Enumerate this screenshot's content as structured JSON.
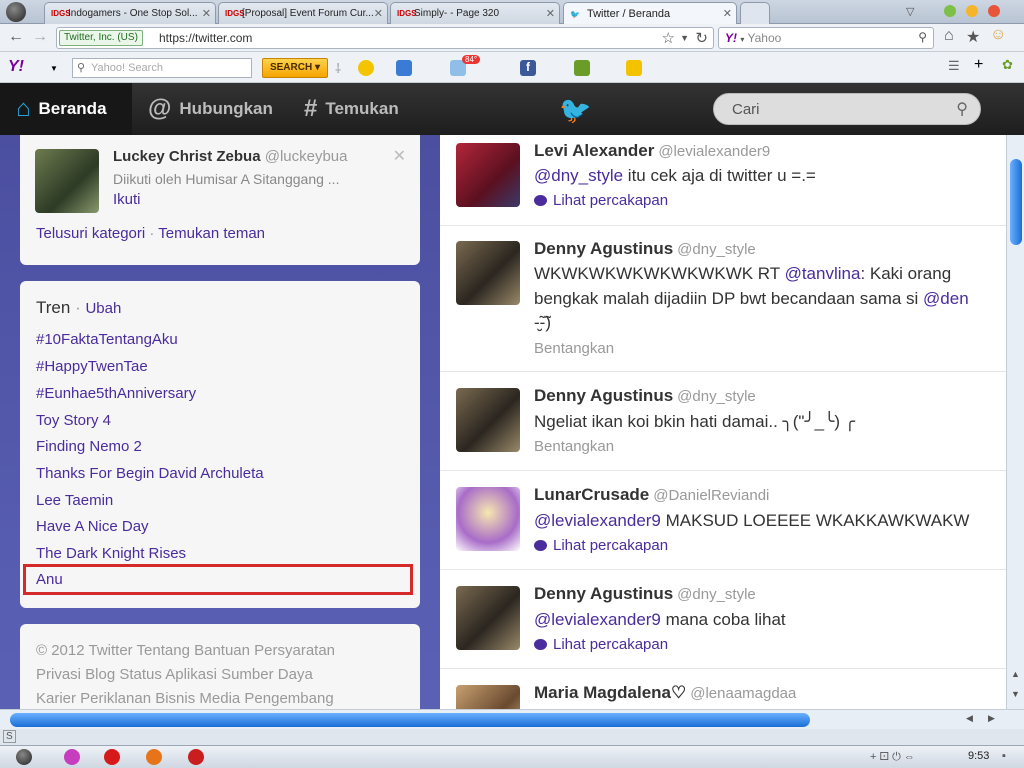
{
  "browser": {
    "tabs": [
      {
        "label": "Indogamers - One Stop Sol...",
        "fav": "IDGS"
      },
      {
        "label": "[Proposal] Event Forum Cur...",
        "fav": "IDGS"
      },
      {
        "label": "Simply- - Page 320",
        "fav": "IDGS"
      },
      {
        "label": "Twitter / Beranda",
        "fav": "twitter-bird"
      }
    ],
    "ev_label": "Twitter, Inc. (US)",
    "url": "https://twitter.com",
    "yahoo_placeholder": "Yahoo",
    "yahoo_toolbar_placeholder": "Yahoo! Search",
    "search_button": "SEARCH",
    "weather_badge": "84°"
  },
  "nav": {
    "home": "Beranda",
    "connect": "Hubungkan",
    "discover": "Temukan",
    "search_placeholder": "Cari"
  },
  "who_to_follow": {
    "name": "Luckey Christ Zebua",
    "handle": "@luckeybua",
    "context": "Diikuti oleh Humisar A Sitanggang ...",
    "follow": "Ikuti",
    "browse": "Telusuri kategori",
    "sep": "·",
    "find_friends": "Temukan teman"
  },
  "trends": {
    "title": "Tren",
    "sep": "·",
    "change": "Ubah",
    "items": [
      "#10FaktaTentangAku",
      "#HappyTwenTae",
      "#Eunhae5thAnniversary",
      "Toy Story 4",
      "Finding Nemo 2",
      "Thanks For Begin David Archuleta",
      "Lee Taemin",
      "Have A Nice Day",
      "The Dark Knight Rises",
      "Anu"
    ]
  },
  "footer": {
    "line1": "© 2012 Twitter  Tentang  Bantuan  Persyaratan",
    "line2": "Privasi  Blog  Status  Aplikasi  Sumber Daya",
    "line3": "Karier  Periklanan  Bisnis  Media  Pengembang"
  },
  "tweets": [
    {
      "name": "Levi Alexander",
      "handle": "@levialexander9",
      "mention": "@dny_style",
      "text": " itu cek aja di twitter u =.=",
      "action": "Lihat percakapan"
    },
    {
      "name": "Denny Agustinus",
      "handle": "@dny_style",
      "text1a": "WKWKWKWKWKWKWKWK RT ",
      "mention1": "@tanvlina",
      "text1b": ": Kaki orang",
      "text2a": "bengkak malah dijadiin DP bwt becandaan sama si ",
      "mention2": "@den",
      "text3": "-̮̮̃-̃)",
      "action": "Bentangkan"
    },
    {
      "name": "Denny Agustinus",
      "handle": "@dny_style",
      "text": "Ngeliat ikan koi bkin hati damai.. ╮(\"╯_╰) ╭",
      "action": "Bentangkan"
    },
    {
      "name": "LunarCrusade",
      "handle": "@DanielReviandi",
      "mention": "@levialexander9",
      "text": " MAKSUD LOEEEE WKAKKAWKWAKW",
      "action": "Lihat percakapan"
    },
    {
      "name": "Denny Agustinus",
      "handle": "@dny_style",
      "mention": "@levialexander9",
      "text": " mana coba lihat",
      "action": "Lihat percakapan"
    },
    {
      "name": "Maria Magdalena♡",
      "handle": "@lenaamagdaa"
    }
  ],
  "clock": "9:53"
}
